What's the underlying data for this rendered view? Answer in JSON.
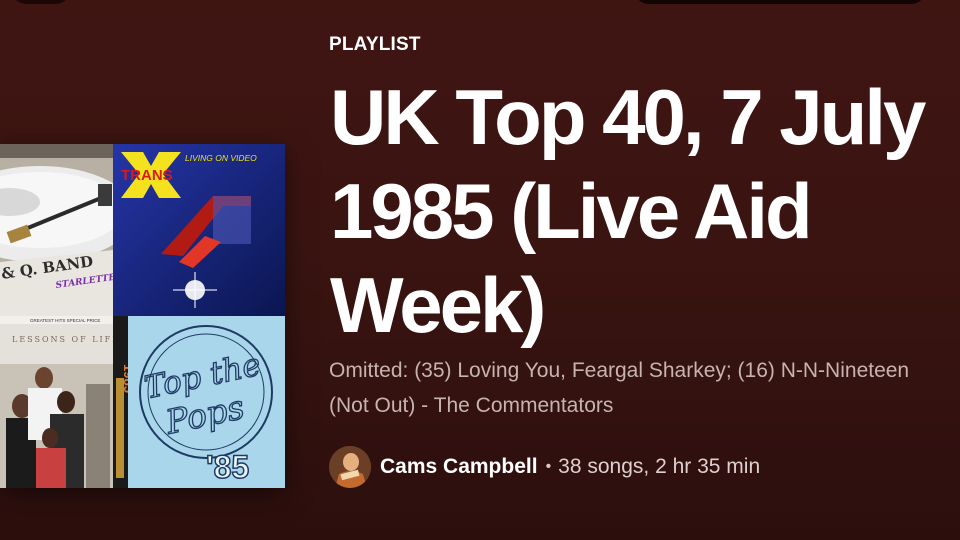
{
  "playlist": {
    "type_label": "PLAYLIST",
    "title_lines": [
      "UK Top 40, 7 July",
      "1985 (Live Aid",
      "Week)"
    ],
    "description_lines": [
      "Omitted: (35) Loving You, Feargal Sharkey; (16) N-N-Nineteen",
      "(Not Out) - The Commentators"
    ],
    "owner": "Cams Campbell",
    "separator": "•",
    "stats": "38 songs, 2 hr 35 min"
  },
  "cover": {
    "tile1": {
      "text": "& Q. BAND",
      "subtext": "STARLETTE"
    },
    "tile2": {
      "title": "TRANS",
      "letter": "X",
      "subtitle": "LIVING ON VIDEO"
    },
    "tile3": {
      "header": "GREATEST HITS SPECIAL PRICE",
      "subtitle": "LESSONS OF LIFE",
      "year": "1985"
    },
    "tile4": {
      "line1": "Top the",
      "line2": "Pops",
      "year": "'85"
    }
  },
  "colors": {
    "background": "#3f1512",
    "text_primary": "#ffffff",
    "text_secondary": "#c7b3b0"
  }
}
